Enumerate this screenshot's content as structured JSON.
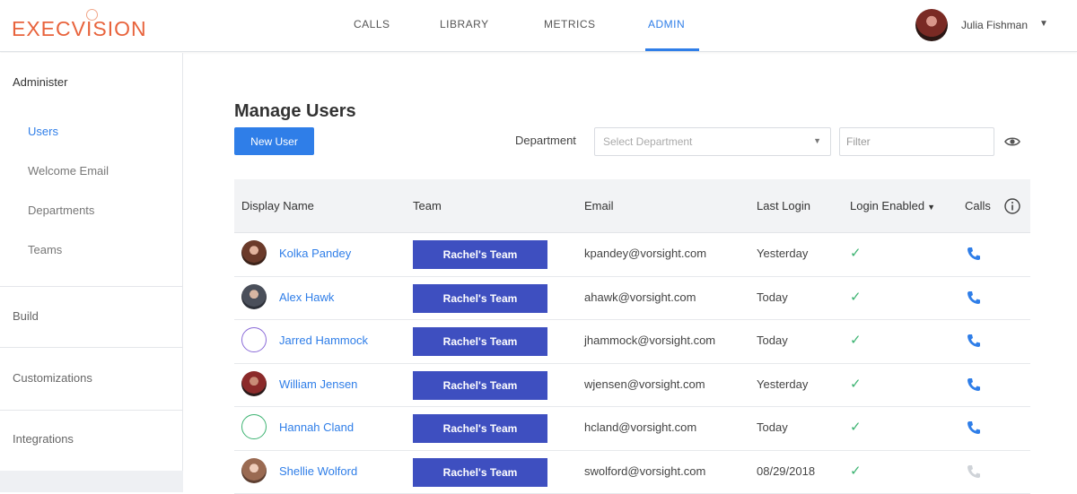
{
  "app": {
    "logo": "EXECVISION"
  },
  "nav": {
    "items": [
      {
        "label": "CALLS",
        "active": false
      },
      {
        "label": "LIBRARY",
        "active": false
      },
      {
        "label": "METRICS",
        "active": false
      },
      {
        "label": "ADMIN",
        "active": true
      }
    ]
  },
  "user": {
    "name": "Julia Fishman"
  },
  "sidebar": {
    "heading": "Administer",
    "sub_items": [
      {
        "label": "Users",
        "active": true
      },
      {
        "label": "Welcome Email",
        "active": false
      },
      {
        "label": "Departments",
        "active": false
      },
      {
        "label": "Teams",
        "active": false
      }
    ],
    "sections": [
      "Build",
      "Customizations",
      "Integrations"
    ]
  },
  "main": {
    "title": "Manage Users",
    "new_user_label": "New User",
    "department_label": "Department",
    "department_placeholder": "Select Department",
    "filter_placeholder": "Filter"
  },
  "table": {
    "headers": {
      "display_name": "Display Name",
      "team": "Team",
      "email": "Email",
      "last_login": "Last Login",
      "login_enabled": "Login Enabled",
      "calls": "Calls"
    },
    "rows": [
      {
        "name": "Kolka Pandey",
        "team": "Rachel's Team",
        "email": "kpandey@vorsight.com",
        "last_login": "Yesterday",
        "login_enabled": "✓",
        "has_calls": true,
        "avatar": "photo-female-1"
      },
      {
        "name": "Alex Hawk",
        "team": "Rachel's Team",
        "email": "ahawk@vorsight.com",
        "last_login": "Today",
        "login_enabled": "✓",
        "has_calls": true,
        "avatar": "photo-male-1"
      },
      {
        "name": "Jarred Hammock",
        "team": "Rachel's Team",
        "email": "jhammock@vorsight.com",
        "last_login": "Today",
        "login_enabled": "✓",
        "has_calls": true,
        "avatar": "placeholder-purple"
      },
      {
        "name": "William Jensen",
        "team": "Rachel's Team",
        "email": "wjensen@vorsight.com",
        "last_login": "Yesterday",
        "login_enabled": "✓",
        "has_calls": true,
        "avatar": "photo-male-2"
      },
      {
        "name": "Hannah Cland",
        "team": "Rachel's Team",
        "email": "hcland@vorsight.com",
        "last_login": "Today",
        "login_enabled": "✓",
        "has_calls": true,
        "avatar": "placeholder-green"
      },
      {
        "name": "Shellie Wolford",
        "team": "Rachel's Team",
        "email": "swolford@vorsight.com",
        "last_login": "08/29/2018",
        "login_enabled": "✓",
        "has_calls": false,
        "avatar": "photo-female-2"
      }
    ]
  },
  "colors": {
    "accent": "#2f7ee8",
    "brand": "#e8633c",
    "team_chip": "#3e4fc0",
    "check": "#3cb371",
    "phone_inactive": "#cfd3d8"
  }
}
